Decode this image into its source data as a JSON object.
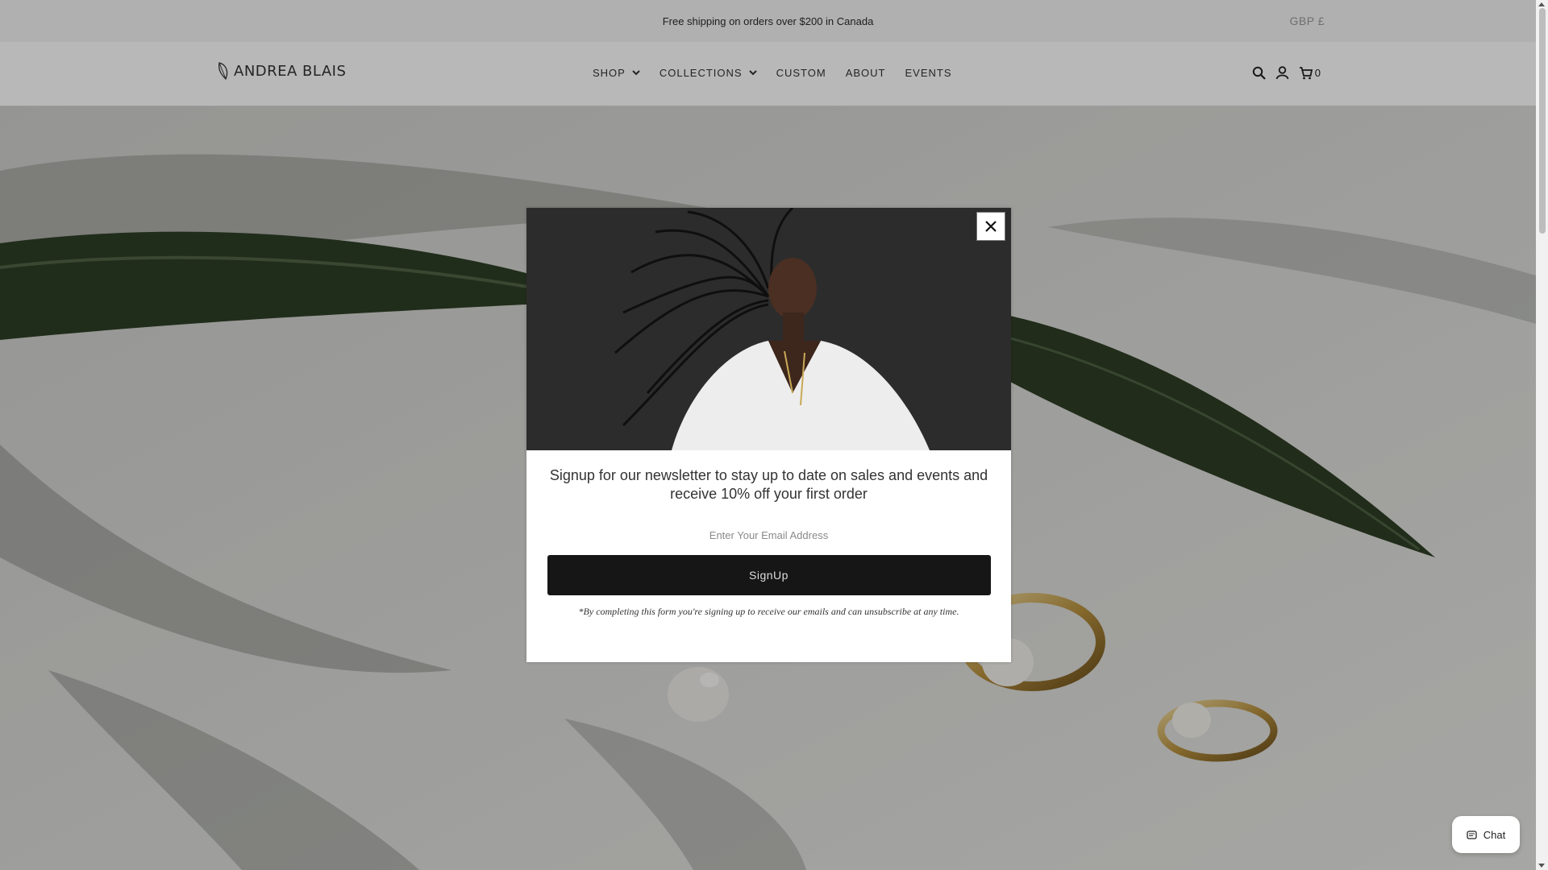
{
  "announcement": {
    "text": "Free shipping on orders over $200 in Canada",
    "currency": "GBP £"
  },
  "header": {
    "logo_text": "ANDREA BLAIS",
    "nav": [
      {
        "label": "SHOP",
        "has_dropdown": true
      },
      {
        "label": "COLLECTIONS",
        "has_dropdown": true
      },
      {
        "label": "CUSTOM",
        "has_dropdown": false
      },
      {
        "label": "ABOUT",
        "has_dropdown": false
      },
      {
        "label": "EVENTS",
        "has_dropdown": false
      }
    ],
    "icons": [
      "search-icon",
      "account-icon",
      "cart-icon"
    ],
    "cart_count": "0"
  },
  "modal": {
    "message": "Signup for our newsletter to stay up to date on sales and events and receive 10% off your first order",
    "email_placeholder": "Enter Your Email Address",
    "button_label": "SignUp",
    "disclaimer": "*By completing this form you're signing up to receive our emails and can unsubscribe at any time."
  },
  "chat": {
    "label": "Chat"
  },
  "colors": {
    "announcement_bg": "#f4f4f4",
    "button_bg": "#161616",
    "overlay": "rgba(0,0,0,0.28)"
  }
}
